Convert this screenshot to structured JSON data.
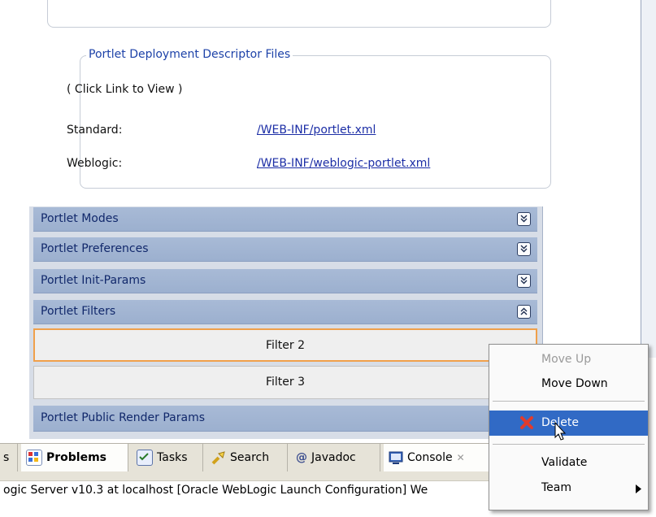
{
  "descriptor": {
    "legend": "Portlet Deployment Descriptor Files",
    "hint": "( Click Link to View )",
    "standard_label": "Standard:",
    "standard_link": "/WEB-INF/portlet.xml",
    "weblogic_label": "Weblogic:",
    "weblogic_link": "/WEB-INF/weblogic-portlet.xml"
  },
  "sections": {
    "modes": "Portlet Modes",
    "preferences": "Portlet Preferences",
    "init_params": "Portlet Init-Params",
    "filters": "Portlet Filters",
    "public_render_params": "Portlet Public Render Params"
  },
  "filters": {
    "filter2": "Filter 2",
    "filter3": "Filter 3"
  },
  "tabs": {
    "partial": "s",
    "problems": "Problems",
    "tasks": "Tasks",
    "search": "Search",
    "javadoc": "Javadoc",
    "console": "Console",
    "javadoc_prefix": "@"
  },
  "console_text": "ogic Server v10.3 at localhost [Oracle WebLogic Launch Configuration] We",
  "context_menu": {
    "move_up": "Move Up",
    "move_down": "Move Down",
    "delete": "Delete",
    "validate": "Validate",
    "team": "Team"
  },
  "colors": {
    "section_bg": "#9fb3d2",
    "menu_selection": "#316ac5",
    "link": "#1c2ea6",
    "focus_border": "#f0a04b"
  },
  "icons": {
    "expand": "chevron-double-down-icon",
    "collapse": "chevron-double-up-icon",
    "delete": "red-x-icon",
    "submenu": "triangle-right-icon"
  }
}
